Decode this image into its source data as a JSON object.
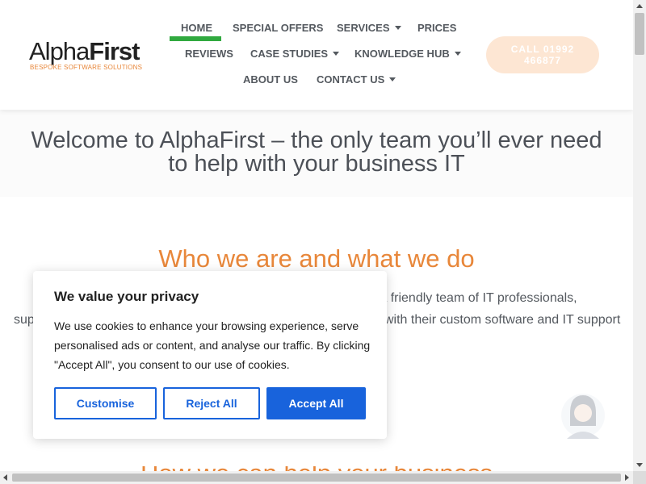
{
  "header": {
    "logo": {
      "alpha": "Alpha",
      "first": "First",
      "tagline": "BESPOKE SOFTWARE SOLUTIONS"
    },
    "nav": {
      "home": "HOME",
      "special_offers": "SPECIAL OFFERS",
      "services": "SERVICES",
      "prices": "PRICES",
      "reviews": "REVIEWS",
      "case_studies": "CASE STUDIES",
      "knowledge_hub": "KNOWLEDGE HUB",
      "about_us": "ABOUT US",
      "contact_us": "CONTACT US"
    },
    "call_button": "CALL 01992 466877"
  },
  "hero": {
    "title_line1": "Welcome to AlphaFirst – the only team you’ll ever need",
    "title_line2": "to help with your business IT"
  },
  "who": {
    "title": "Who we are and what we do",
    "line1_visible": "e a friendly team of IT professionals,",
    "line2_left": "sup",
    "line2_right": "with their custom software and IT support",
    "next_heading": "How we can help your business"
  },
  "cookie": {
    "title": "We value your privacy",
    "text": "We use cookies to enhance your browsing experience, serve personalised ads or content, and analyse our traffic. By clicking \"Accept All\", you consent to our use of cookies.",
    "customise": "Customise",
    "reject": "Reject All",
    "accept": "Accept All"
  },
  "colors": {
    "accent_orange": "#e8873a",
    "active_green": "#30a93f",
    "cookie_blue": "#1863dc"
  }
}
